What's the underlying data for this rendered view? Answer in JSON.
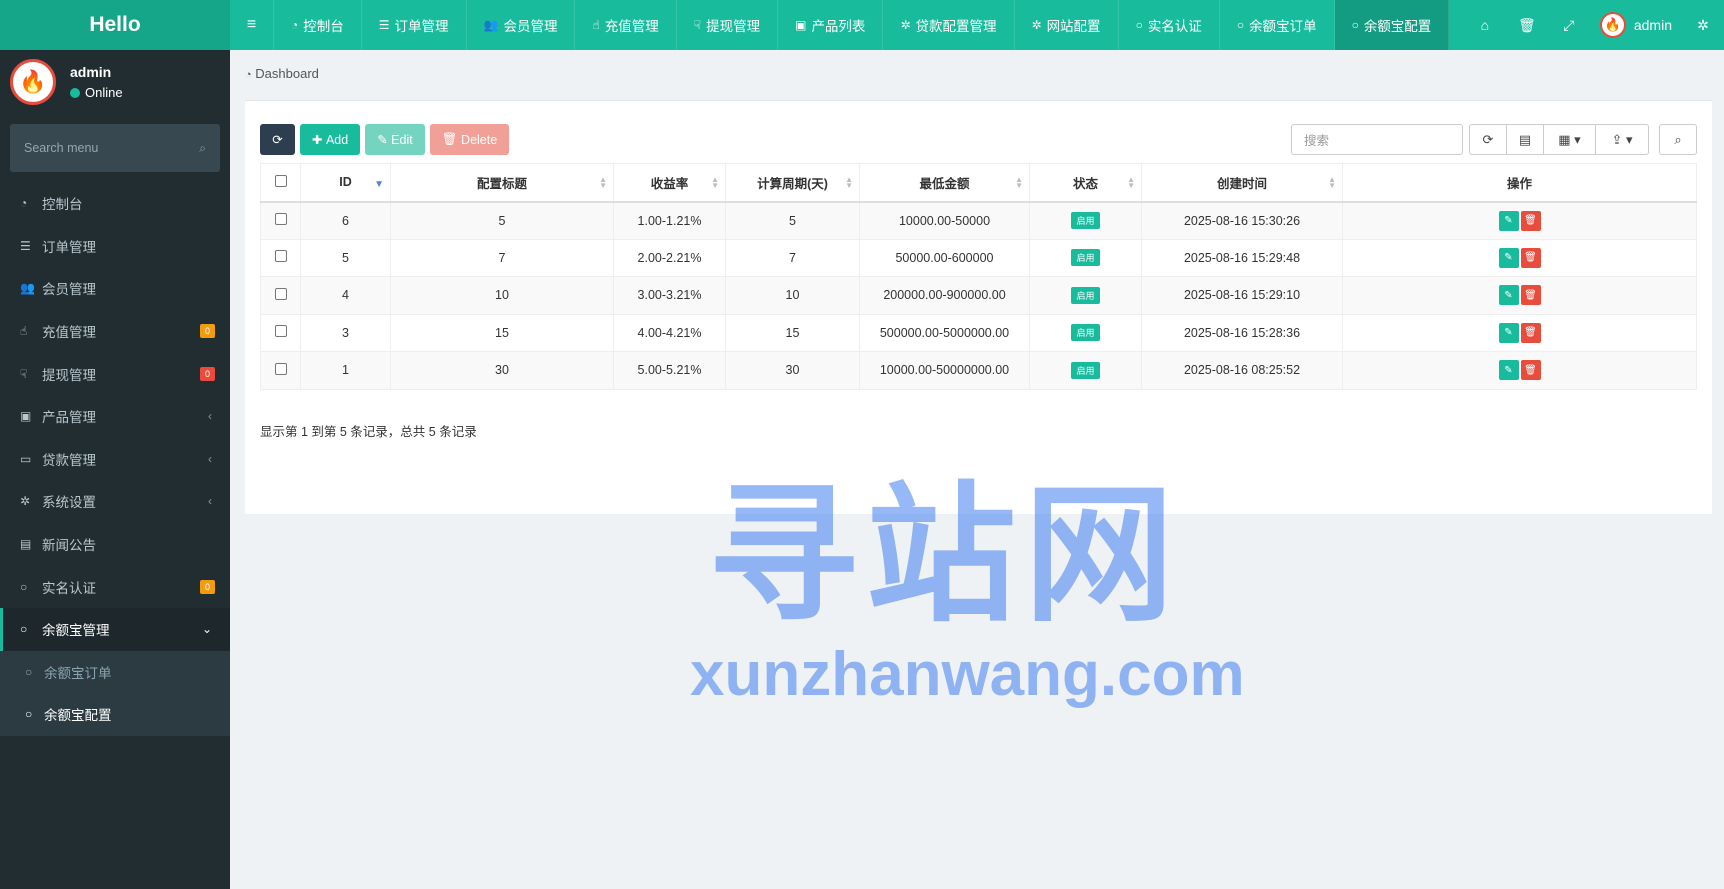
{
  "logo": "Hello",
  "topnav": {
    "tabs": [
      {
        "label": "控制台",
        "icon": "dashboard-icon",
        "glyph": "◔"
      },
      {
        "label": "订单管理",
        "icon": "list-icon",
        "glyph": "☰"
      },
      {
        "label": "会员管理",
        "icon": "users-icon",
        "glyph": "👥"
      },
      {
        "label": "充值管理",
        "icon": "hand-icon",
        "glyph": "☝"
      },
      {
        "label": "提现管理",
        "icon": "hand-down-icon",
        "glyph": "☟"
      },
      {
        "label": "产品列表",
        "icon": "shopping-bag-icon",
        "glyph": "▣"
      },
      {
        "label": "贷款配置管理",
        "icon": "gear-icon",
        "glyph": "✲"
      },
      {
        "label": "网站配置",
        "icon": "gear-icon",
        "glyph": "✲"
      },
      {
        "label": "实名认证",
        "icon": "circle-icon",
        "glyph": "○"
      },
      {
        "label": "余额宝订单",
        "icon": "circle-icon",
        "glyph": "○"
      },
      {
        "label": "余额宝配置",
        "icon": "circle-icon",
        "glyph": "○"
      }
    ],
    "user": "admin"
  },
  "sidebar": {
    "username": "admin",
    "status": "Online",
    "search_placeholder": "Search menu",
    "items": [
      {
        "label": "控制台",
        "icon": "dashboard-icon",
        "glyph": "◔"
      },
      {
        "label": "订单管理",
        "icon": "list-icon",
        "glyph": "☰"
      },
      {
        "label": "会员管理",
        "icon": "users-icon",
        "glyph": "👥"
      },
      {
        "label": "充值管理",
        "icon": "hand-icon",
        "glyph": "☝",
        "badge": "0"
      },
      {
        "label": "提现管理",
        "icon": "hand-down-icon",
        "glyph": "☟",
        "badge": "0"
      },
      {
        "label": "产品管理",
        "icon": "shopping-bag-icon",
        "glyph": "▣"
      },
      {
        "label": "贷款管理",
        "icon": "credit-card-icon",
        "glyph": "▭"
      },
      {
        "label": "系统设置",
        "icon": "gears-icon",
        "glyph": "✲"
      },
      {
        "label": "新闻公告",
        "icon": "newspaper-icon",
        "glyph": "▤"
      },
      {
        "label": "实名认证",
        "icon": "circle-icon",
        "glyph": "○",
        "badge": "0"
      },
      {
        "label": "余额宝管理",
        "icon": "circle-icon",
        "glyph": "○"
      }
    ],
    "sub_items": [
      {
        "label": "余额宝订单"
      },
      {
        "label": "余额宝配置"
      }
    ]
  },
  "breadcrumb": "Dashboard",
  "toolbar": {
    "add": "Add",
    "edit": "Edit",
    "delete": "Delete",
    "search_placeholder": "搜索"
  },
  "table": {
    "headers": [
      "ID",
      "配置标题",
      "收益率",
      "计算周期(天)",
      "最低金额",
      "状态",
      "创建时间",
      "操作"
    ],
    "rows": [
      {
        "id": "6",
        "title": "5",
        "rate": "1.00-1.21%",
        "period": "5",
        "amount": "10000.00-50000",
        "status": "启用",
        "created": "2025-08-16 15:30:26"
      },
      {
        "id": "5",
        "title": "7",
        "rate": "2.00-2.21%",
        "period": "7",
        "amount": "50000.00-600000",
        "status": "启用",
        "created": "2025-08-16 15:29:48"
      },
      {
        "id": "4",
        "title": "10",
        "rate": "3.00-3.21%",
        "period": "10",
        "amount": "200000.00-900000.00",
        "status": "启用",
        "created": "2025-08-16 15:29:10"
      },
      {
        "id": "3",
        "title": "15",
        "rate": "4.00-4.21%",
        "period": "15",
        "amount": "500000.00-5000000.00",
        "status": "启用",
        "created": "2025-08-16 15:28:36"
      },
      {
        "id": "1",
        "title": "30",
        "rate": "5.00-5.21%",
        "period": "30",
        "amount": "10000.00-50000000.00",
        "status": "启用",
        "created": "2025-08-16 08:25:52"
      }
    ]
  },
  "pager_info": "显示第 1 到第 5 条记录，总共 5 条记录",
  "watermark": {
    "cn": "寻站网",
    "en": "xunzhanwang.com"
  }
}
